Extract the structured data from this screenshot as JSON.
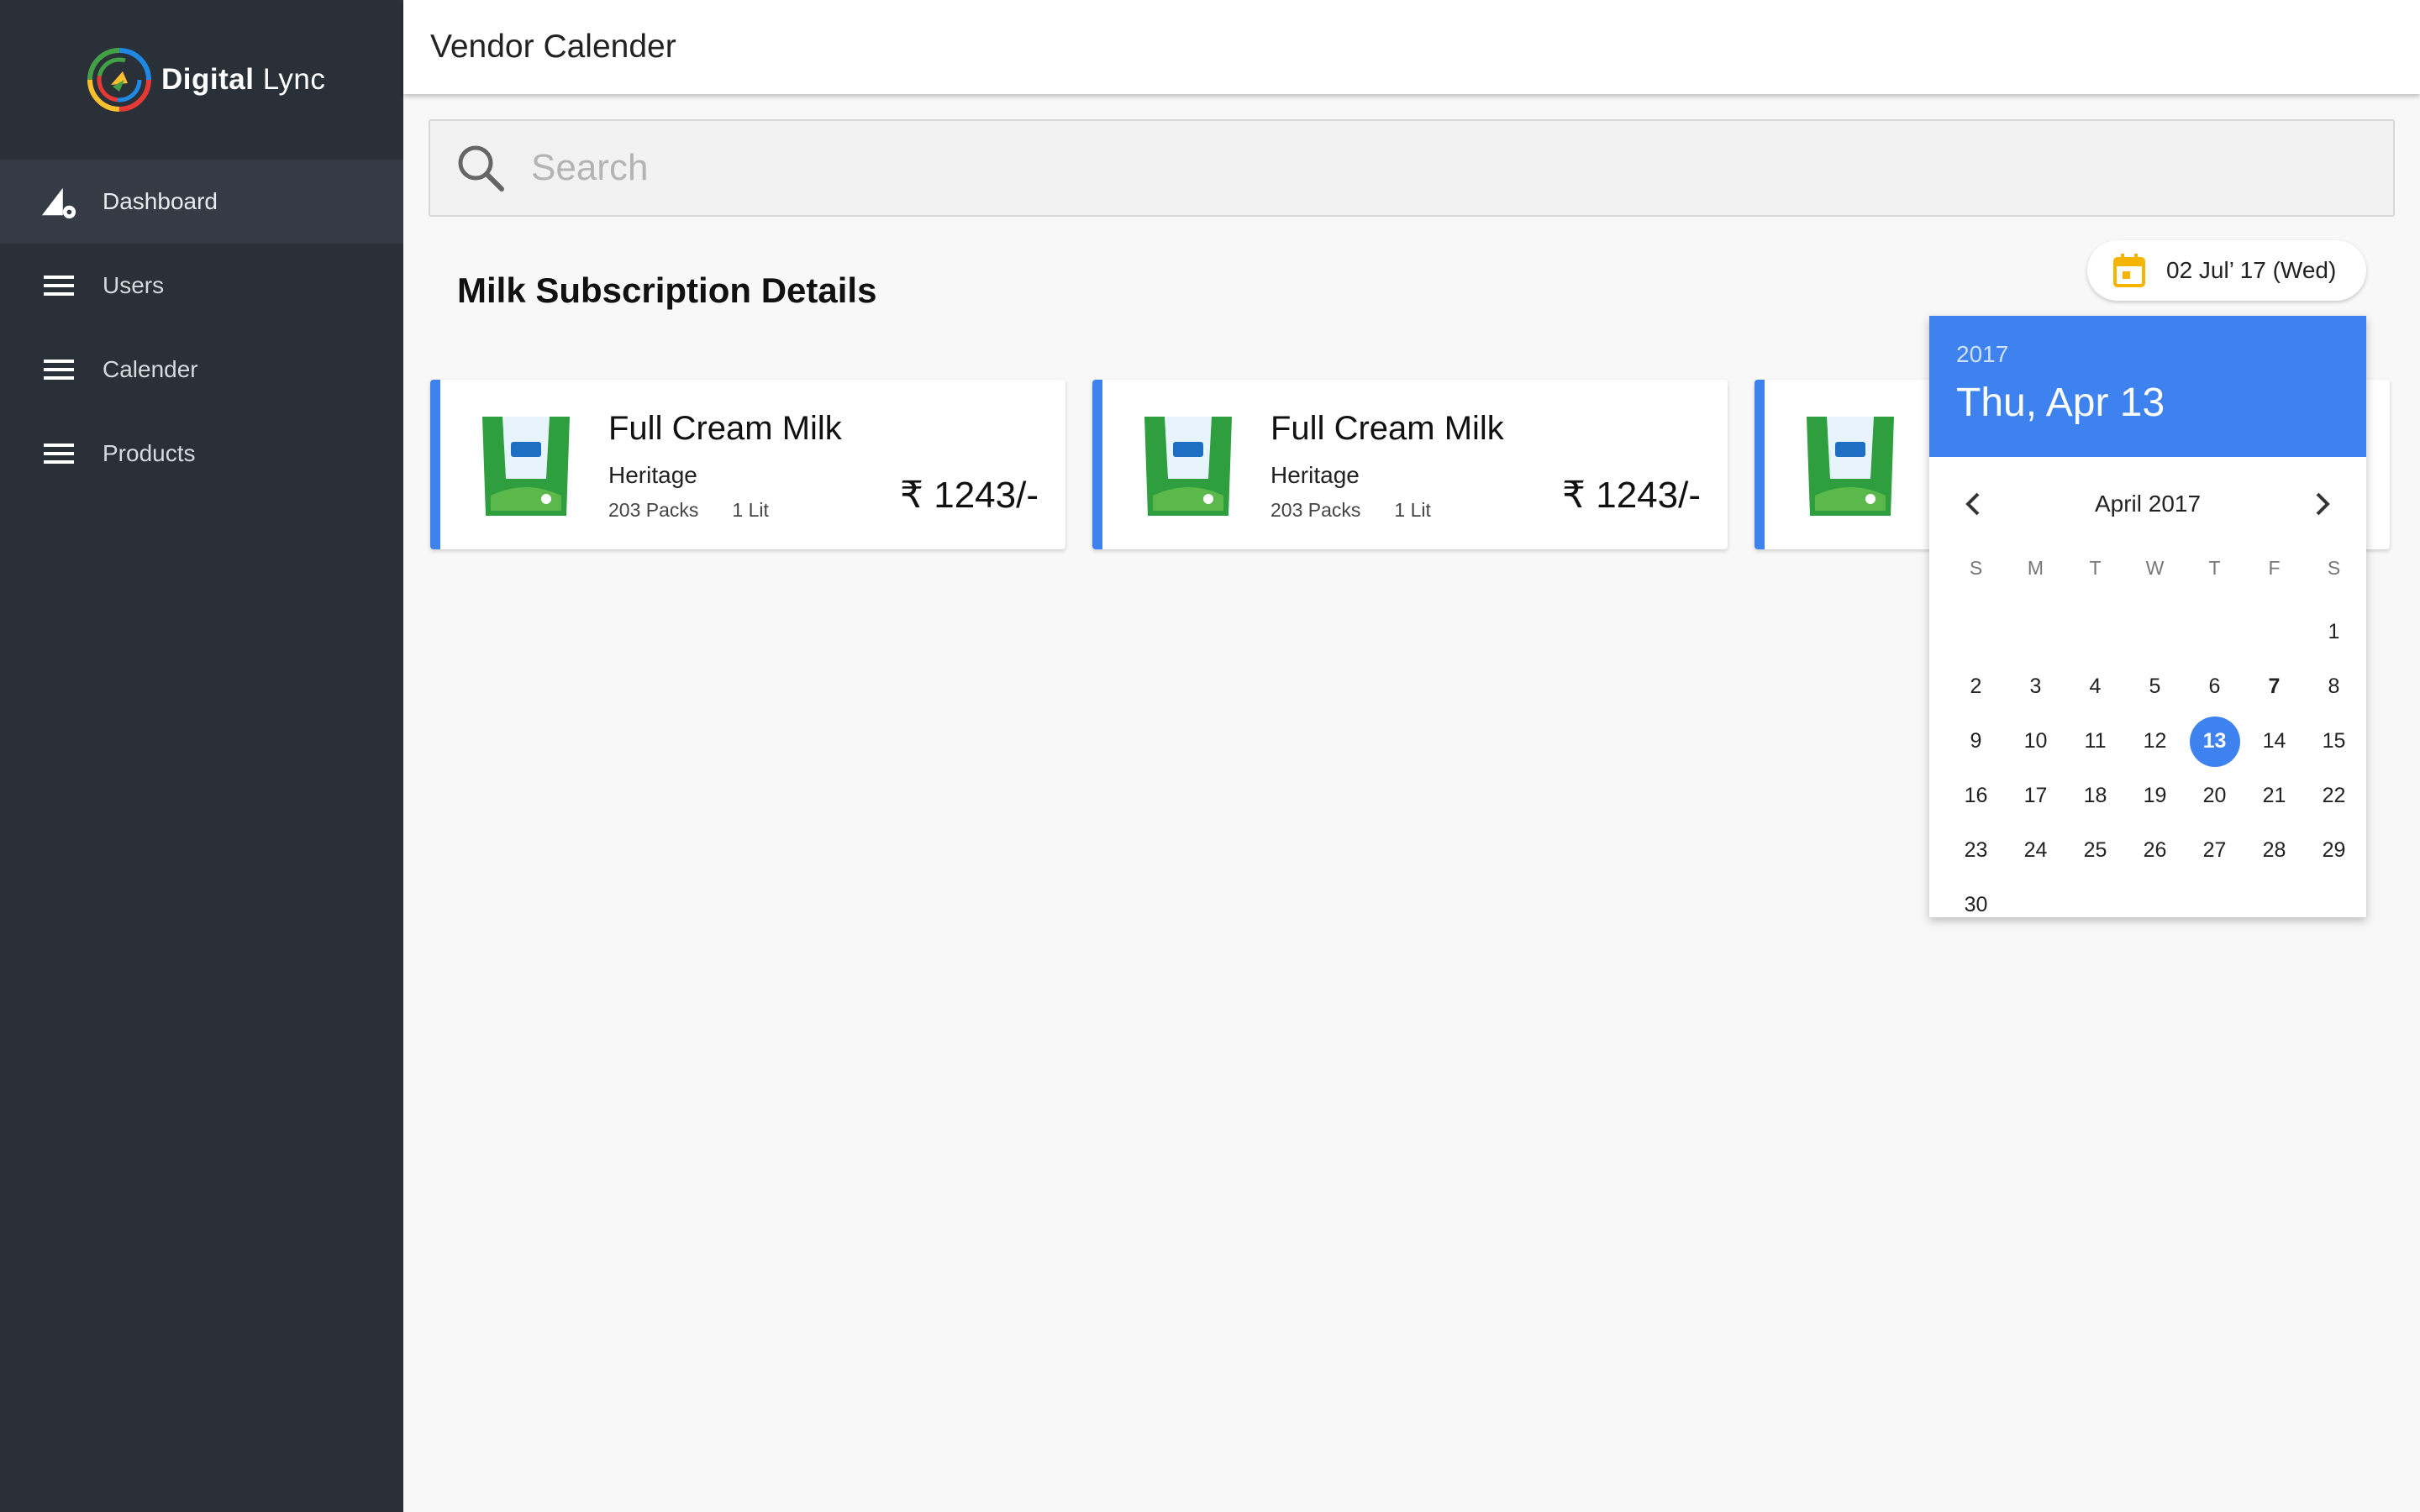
{
  "brand": {
    "name_bold": "Digital",
    "name_light": "Lync"
  },
  "sidebar": {
    "items": [
      {
        "label": "Dashboard",
        "icon": "dashboard-icon"
      },
      {
        "label": "Users",
        "icon": "menu-icon"
      },
      {
        "label": "Calender",
        "icon": "menu-icon"
      },
      {
        "label": "Products",
        "icon": "menu-icon"
      }
    ]
  },
  "header": {
    "title": "Vendor Calender"
  },
  "search": {
    "placeholder": "Search",
    "value": ""
  },
  "section": {
    "title": "Milk Subscription Details"
  },
  "date_chip": {
    "label": "02 Jul’ 17 (Wed)",
    "icon": "calendar-icon",
    "icon_color": "#f5b400"
  },
  "cards": [
    {
      "name": "Full Cream Milk",
      "brand": "Heritage",
      "packs": "203 Packs",
      "volume": "1 Lit",
      "price": "₹ 1243/-"
    },
    {
      "name": "Full Cream Milk",
      "brand": "Heritage",
      "packs": "203 Packs",
      "volume": "1 Lit",
      "price": "₹ 1243/-"
    },
    {
      "name": "",
      "brand": "",
      "packs": "",
      "volume": "",
      "price": ""
    }
  ],
  "date_picker": {
    "year": "2017",
    "selected_label": "Thu, Apr 13",
    "month_label": "April 2017",
    "weekdays": [
      "S",
      "M",
      "T",
      "W",
      "T",
      "F",
      "S"
    ],
    "days": [
      "",
      "",
      "",
      "",
      "",
      "",
      "1",
      "2",
      "3",
      "4",
      "5",
      "6",
      "7",
      "8",
      "9",
      "10",
      "11",
      "12",
      "13",
      "14",
      "15",
      "16",
      "17",
      "18",
      "19",
      "20",
      "21",
      "22",
      "23",
      "24",
      "25",
      "26",
      "27",
      "28",
      "29",
      "30"
    ],
    "selected_day": "13",
    "bold_day": "7",
    "accent": "#3e82f0"
  },
  "colors": {
    "sidebar": "#2a3038",
    "accent": "#3e82f0"
  }
}
